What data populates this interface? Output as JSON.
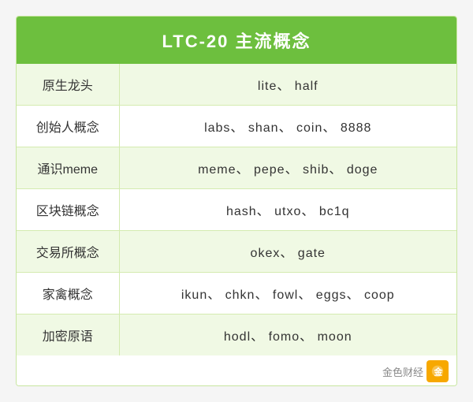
{
  "header": {
    "title": "LTC-20 主流概念"
  },
  "rows": [
    {
      "label": "原生龙头",
      "value": "lite、 half"
    },
    {
      "label": "创始人概念",
      "value": "labs、 shan、 coin、 8888"
    },
    {
      "label": "通识meme",
      "value": "meme、 pepe、 shib、 doge"
    },
    {
      "label": "区块链概念",
      "value": "hash、 utxo、 bc1q"
    },
    {
      "label": "交易所概念",
      "value": "okex、 gate"
    },
    {
      "label": "家禽概念",
      "value": "ikun、 chkn、 fowl、 eggs、 coop"
    },
    {
      "label": "加密原语",
      "value": "hodl、 fomo、 moon"
    }
  ],
  "watermark": {
    "text": "金色财经",
    "icon_label": "gold-finance-icon"
  }
}
